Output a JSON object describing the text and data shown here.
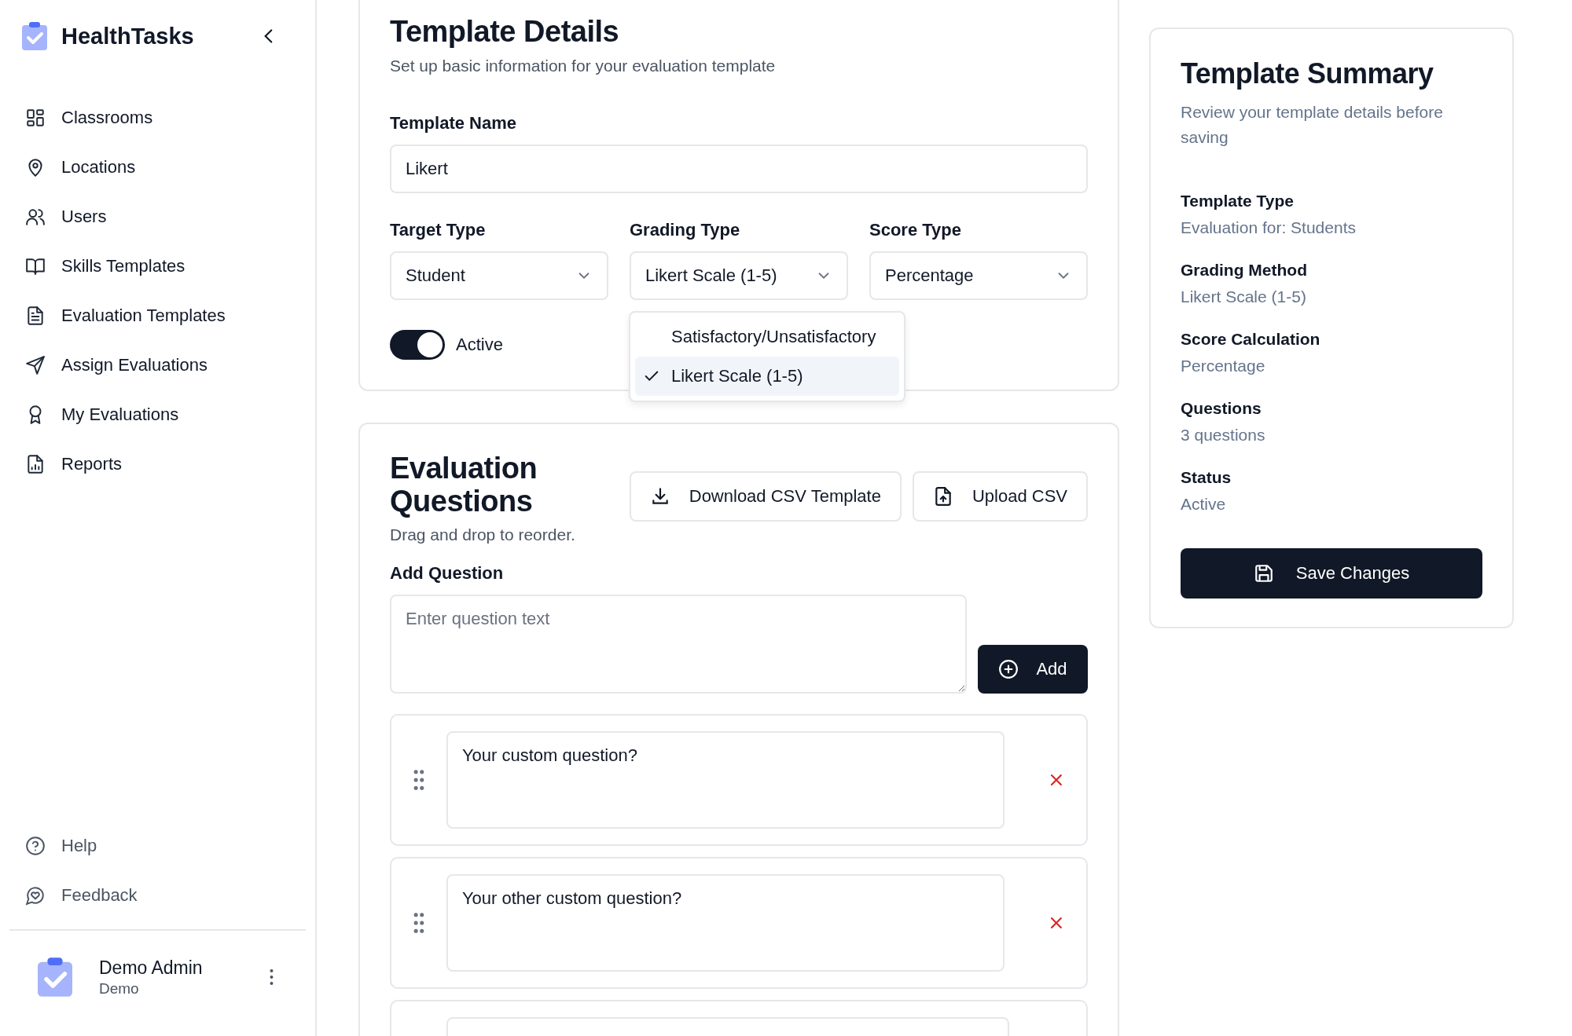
{
  "sidebar": {
    "app_name": "HealthTasks",
    "items": [
      {
        "label": "Classrooms"
      },
      {
        "label": "Locations"
      },
      {
        "label": "Users"
      },
      {
        "label": "Skills Templates"
      },
      {
        "label": "Evaluation Templates"
      },
      {
        "label": "Assign Evaluations"
      },
      {
        "label": "My Evaluations"
      },
      {
        "label": "Reports"
      }
    ],
    "footer_items": [
      {
        "label": "Help"
      },
      {
        "label": "Feedback"
      }
    ],
    "user": {
      "name": "Demo Admin",
      "role": "Demo"
    }
  },
  "details": {
    "title": "Template Details",
    "subtitle": "Set up basic information for your evaluation template",
    "name_label": "Template Name",
    "name_value": "Likert",
    "selects": [
      {
        "label": "Target Type",
        "value": "Student"
      },
      {
        "label": "Grading Type",
        "value": "Likert Scale (1-5)"
      },
      {
        "label": "Score Type",
        "value": "Percentage"
      }
    ],
    "active": {
      "label": "Active",
      "on": true
    },
    "dropdown": [
      {
        "label": "Satisfactory/Unsatisfactory",
        "selected": false
      },
      {
        "label": "Likert Scale (1-5)",
        "selected": true
      }
    ]
  },
  "questions": {
    "title": "Evaluation Questions",
    "hint": "Drag and drop to reorder.",
    "download_button": "Download CSV Template",
    "upload_button": "Upload CSV",
    "add_label": "Add Question",
    "add_placeholder": "Enter question text",
    "add_button": "Add",
    "items": [
      {
        "kind": "question",
        "text": "Your custom question?"
      },
      {
        "kind": "question",
        "text": "Your other custom question?"
      },
      {
        "kind": "partial"
      }
    ]
  },
  "summary": {
    "title": "Template Summary",
    "subtitle": "Review your template details before saving",
    "rows": [
      {
        "label": "Template Type",
        "value": "Evaluation for: Students"
      },
      {
        "label": "Grading Method",
        "value": "Likert Scale (1-5)"
      },
      {
        "label": "Score Calculation",
        "value": "Percentage"
      },
      {
        "label": "Questions",
        "value": "3 questions"
      },
      {
        "label": "Status",
        "value": "Active"
      }
    ],
    "save_button": "Save Changes"
  }
}
